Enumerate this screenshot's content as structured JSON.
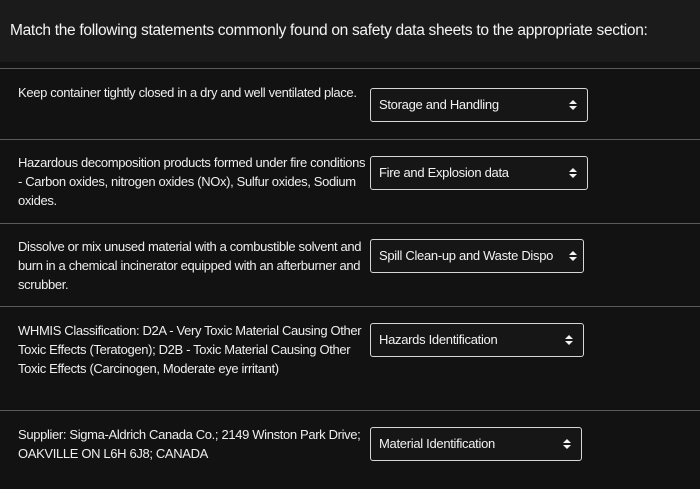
{
  "prompt": "Match the following statements commonly found on safety data sheets to the appropriate section:",
  "items": [
    {
      "statement": "Keep container tightly closed in a dry and well ventilated place.",
      "selected": "Storage and Handling",
      "icon": "caret-updown-icon"
    },
    {
      "statement": "Hazardous decomposition products formed under fire conditions - Carbon oxides, nitrogen oxides (NOx), Sulfur oxides, Sodium oxides.",
      "selected": "Fire and Explosion data",
      "icon": "caret-updown-icon"
    },
    {
      "statement": "Dissolve or mix unused material with a combustible solvent and burn in a chemical incinerator equipped with an afterburner and scrubber.",
      "selected": "Spill Clean-up and Waste Dispo",
      "icon": "caret-updown-icon"
    },
    {
      "statement": "WHMIS Classification: D2A - Very Toxic Material Causing Other Toxic Effects (Teratogen); D2B - Toxic Material Causing Other Toxic Effects (Carcinogen, Moderate eye irritant)",
      "selected": "Hazards Identification",
      "icon": "caret-updown-icon"
    },
    {
      "statement": "Supplier: Sigma-Aldrich Canada Co.; 2149 Winston Park Drive; OAKVILLE ON L6H 6J8; CANADA",
      "selected": "Material Identification",
      "icon": "caret-updown-icon"
    }
  ]
}
